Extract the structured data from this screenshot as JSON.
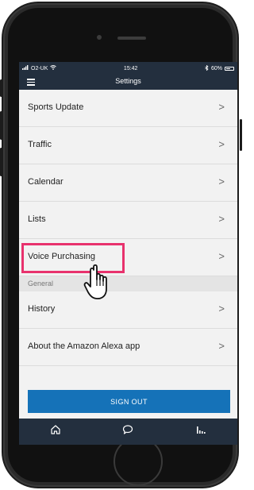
{
  "status_bar": {
    "carrier": "O2-UK",
    "time": "15:42",
    "battery": "60%"
  },
  "header": {
    "title": "Settings"
  },
  "list": {
    "rows_top": [
      {
        "label": "Sports Update"
      },
      {
        "label": "Traffic"
      },
      {
        "label": "Calendar"
      },
      {
        "label": "Lists"
      },
      {
        "label": "Voice Purchasing"
      }
    ],
    "section_label": "General",
    "rows_bottom": [
      {
        "label": "History"
      },
      {
        "label": "About the Amazon Alexa app"
      }
    ]
  },
  "sign_out_label": "SIGN OUT",
  "chevron": ">",
  "colors": {
    "header": "#232f3e",
    "primary_button": "#1572b8",
    "highlight": "#e8326d"
  },
  "tabs": [
    {
      "icon": "home-icon"
    },
    {
      "icon": "chat-bubble-icon"
    },
    {
      "icon": "activity-bars-icon"
    }
  ]
}
